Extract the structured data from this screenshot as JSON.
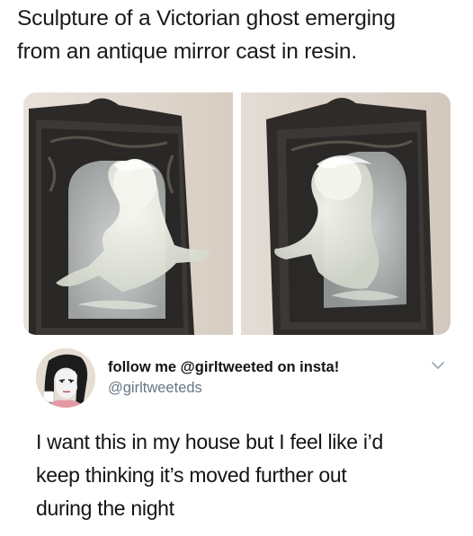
{
  "caption": {
    "line1": "Sculpture of a Victorian ghost emerging",
    "line2": "from an antique mirror cast in resin."
  },
  "photos": [
    {
      "alt": "ghost-mirror-photo-front-view"
    },
    {
      "alt": "ghost-mirror-photo-side-view"
    }
  ],
  "tweet": {
    "display_name": "follow me @girltweeted on insta!",
    "handle": "@girltweeteds",
    "text_line1": "I want this in my house but I feel like i’d",
    "text_line2": "keep thinking it’s moved further out",
    "text_line3": "during the night"
  },
  "icons": {
    "menu": "chevron-down-icon",
    "avatar": "cartoon-avatar"
  },
  "colors": {
    "text": "#141414",
    "handle": "#657786",
    "chevron": "#9aa5b1"
  }
}
